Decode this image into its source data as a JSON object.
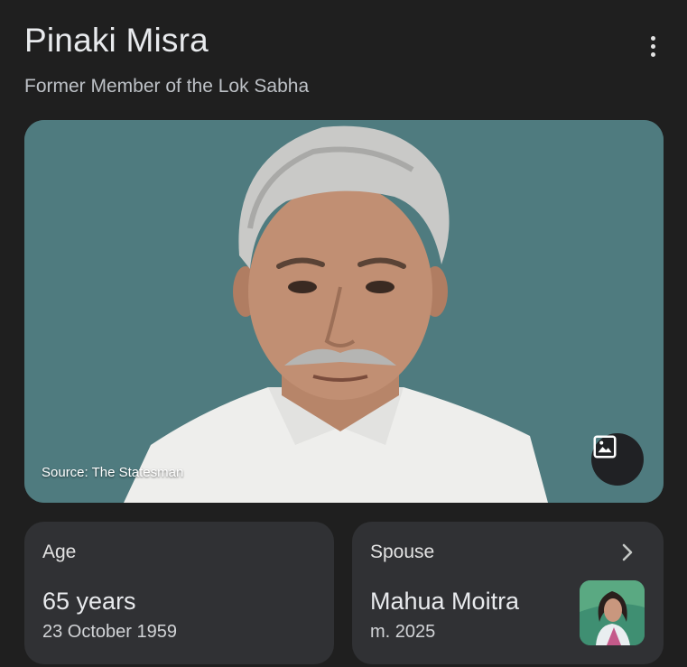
{
  "header": {
    "title": "Pinaki Misra",
    "subtitle": "Former Member of the Lok Sabha",
    "menu_icon": "more-vert-icon"
  },
  "hero": {
    "source": "Source: The Statesman",
    "image_button_icon": "image-icon",
    "background_color": "#4f7b7f"
  },
  "cards": {
    "age": {
      "label": "Age",
      "value": "65 years",
      "detail": "23 October 1959"
    },
    "spouse": {
      "label": "Spouse",
      "value": "Mahua Moitra",
      "detail": "m. 2025",
      "chevron_icon": "chevron-right-icon"
    }
  },
  "colors": {
    "background": "#1f1f1f",
    "card": "#303134",
    "text_primary": "#e8eaed",
    "text_secondary": "#bdc1c6"
  }
}
